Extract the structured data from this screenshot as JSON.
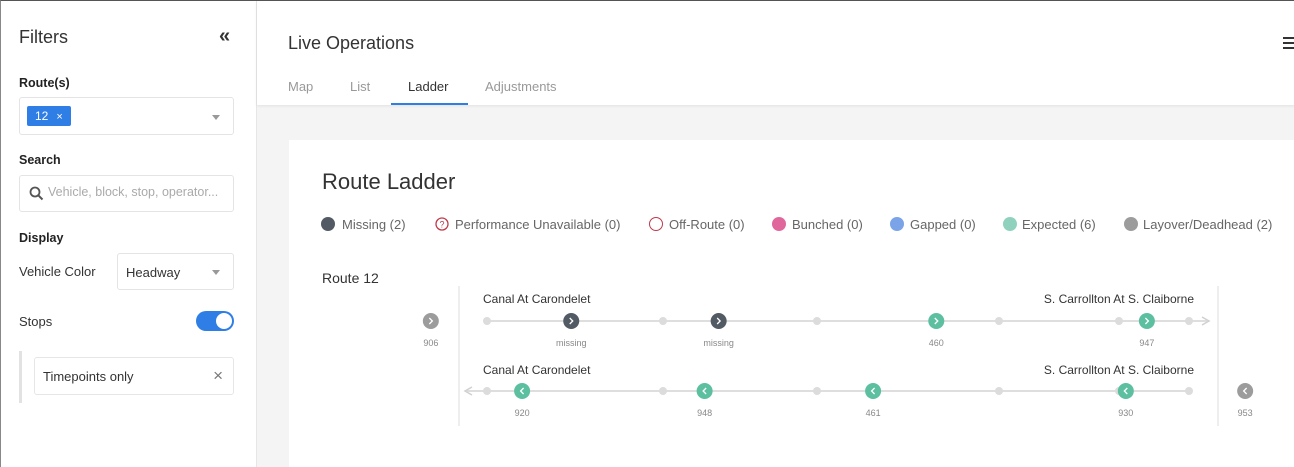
{
  "sidebar": {
    "title": "Filters",
    "routes_label": "Route(s)",
    "route_chip": "12",
    "search_label": "Search",
    "search_placeholder": "Vehicle, block, stop, operator...",
    "display_label": "Display",
    "vehicle_color_label": "Vehicle Color",
    "vehicle_color_value": "Headway",
    "stops_label": "Stops",
    "stops_enabled": true,
    "timepoints_filter": "Timepoints only"
  },
  "header": {
    "title": "Live Operations",
    "tabs": [
      "Map",
      "List",
      "Ladder",
      "Adjustments"
    ],
    "active_tab": "Ladder"
  },
  "card": {
    "title": "Route Ladder",
    "legend": [
      {
        "label": "Missing (2)",
        "color": "#525a63",
        "style": "solid"
      },
      {
        "label": "Performance Unavailable (0)",
        "color": "#c0394b",
        "style": "question"
      },
      {
        "label": "Off-Route (0)",
        "color": "#c0394b",
        "style": "ring"
      },
      {
        "label": "Bunched (0)",
        "color": "#e0679c",
        "style": "solid"
      },
      {
        "label": "Gapped (0)",
        "color": "#7aa3e8",
        "style": "solid"
      },
      {
        "label": "Expected (6)",
        "color": "#8fd1bd",
        "style": "solid"
      },
      {
        "label": "Layover/Deadhead (2)",
        "color": "#9c9c9c",
        "style": "solid"
      }
    ],
    "route_label": "Route 12",
    "ladder": {
      "outbound": {
        "start_stop": "Canal At Carondelet",
        "end_stop": "S. Carrollton At S. Claiborne",
        "vehicles": [
          {
            "id": "906",
            "status": "layover",
            "position": -0.08
          },
          {
            "id": "missing",
            "status": "missing",
            "position": 0.12
          },
          {
            "id": "missing",
            "status": "missing",
            "position": 0.33
          },
          {
            "id": "460",
            "status": "expected",
            "position": 0.64
          },
          {
            "id": "947",
            "status": "expected",
            "position": 0.94
          }
        ]
      },
      "inbound": {
        "start_stop": "Canal At Carondelet",
        "end_stop": "S. Carrollton At S. Claiborne",
        "vehicles": [
          {
            "id": "920",
            "status": "expected",
            "position": 0.05
          },
          {
            "id": "948",
            "status": "expected",
            "position": 0.31
          },
          {
            "id": "461",
            "status": "expected",
            "position": 0.55
          },
          {
            "id": "930",
            "status": "expected",
            "position": 0.91
          },
          {
            "id": "953",
            "status": "layover",
            "position": 1.08
          }
        ]
      }
    }
  },
  "colors": {
    "accent": "#2f7ee6",
    "missing": "#525a63",
    "expected": "#5bbfa0",
    "layover": "#9c9c9c"
  }
}
